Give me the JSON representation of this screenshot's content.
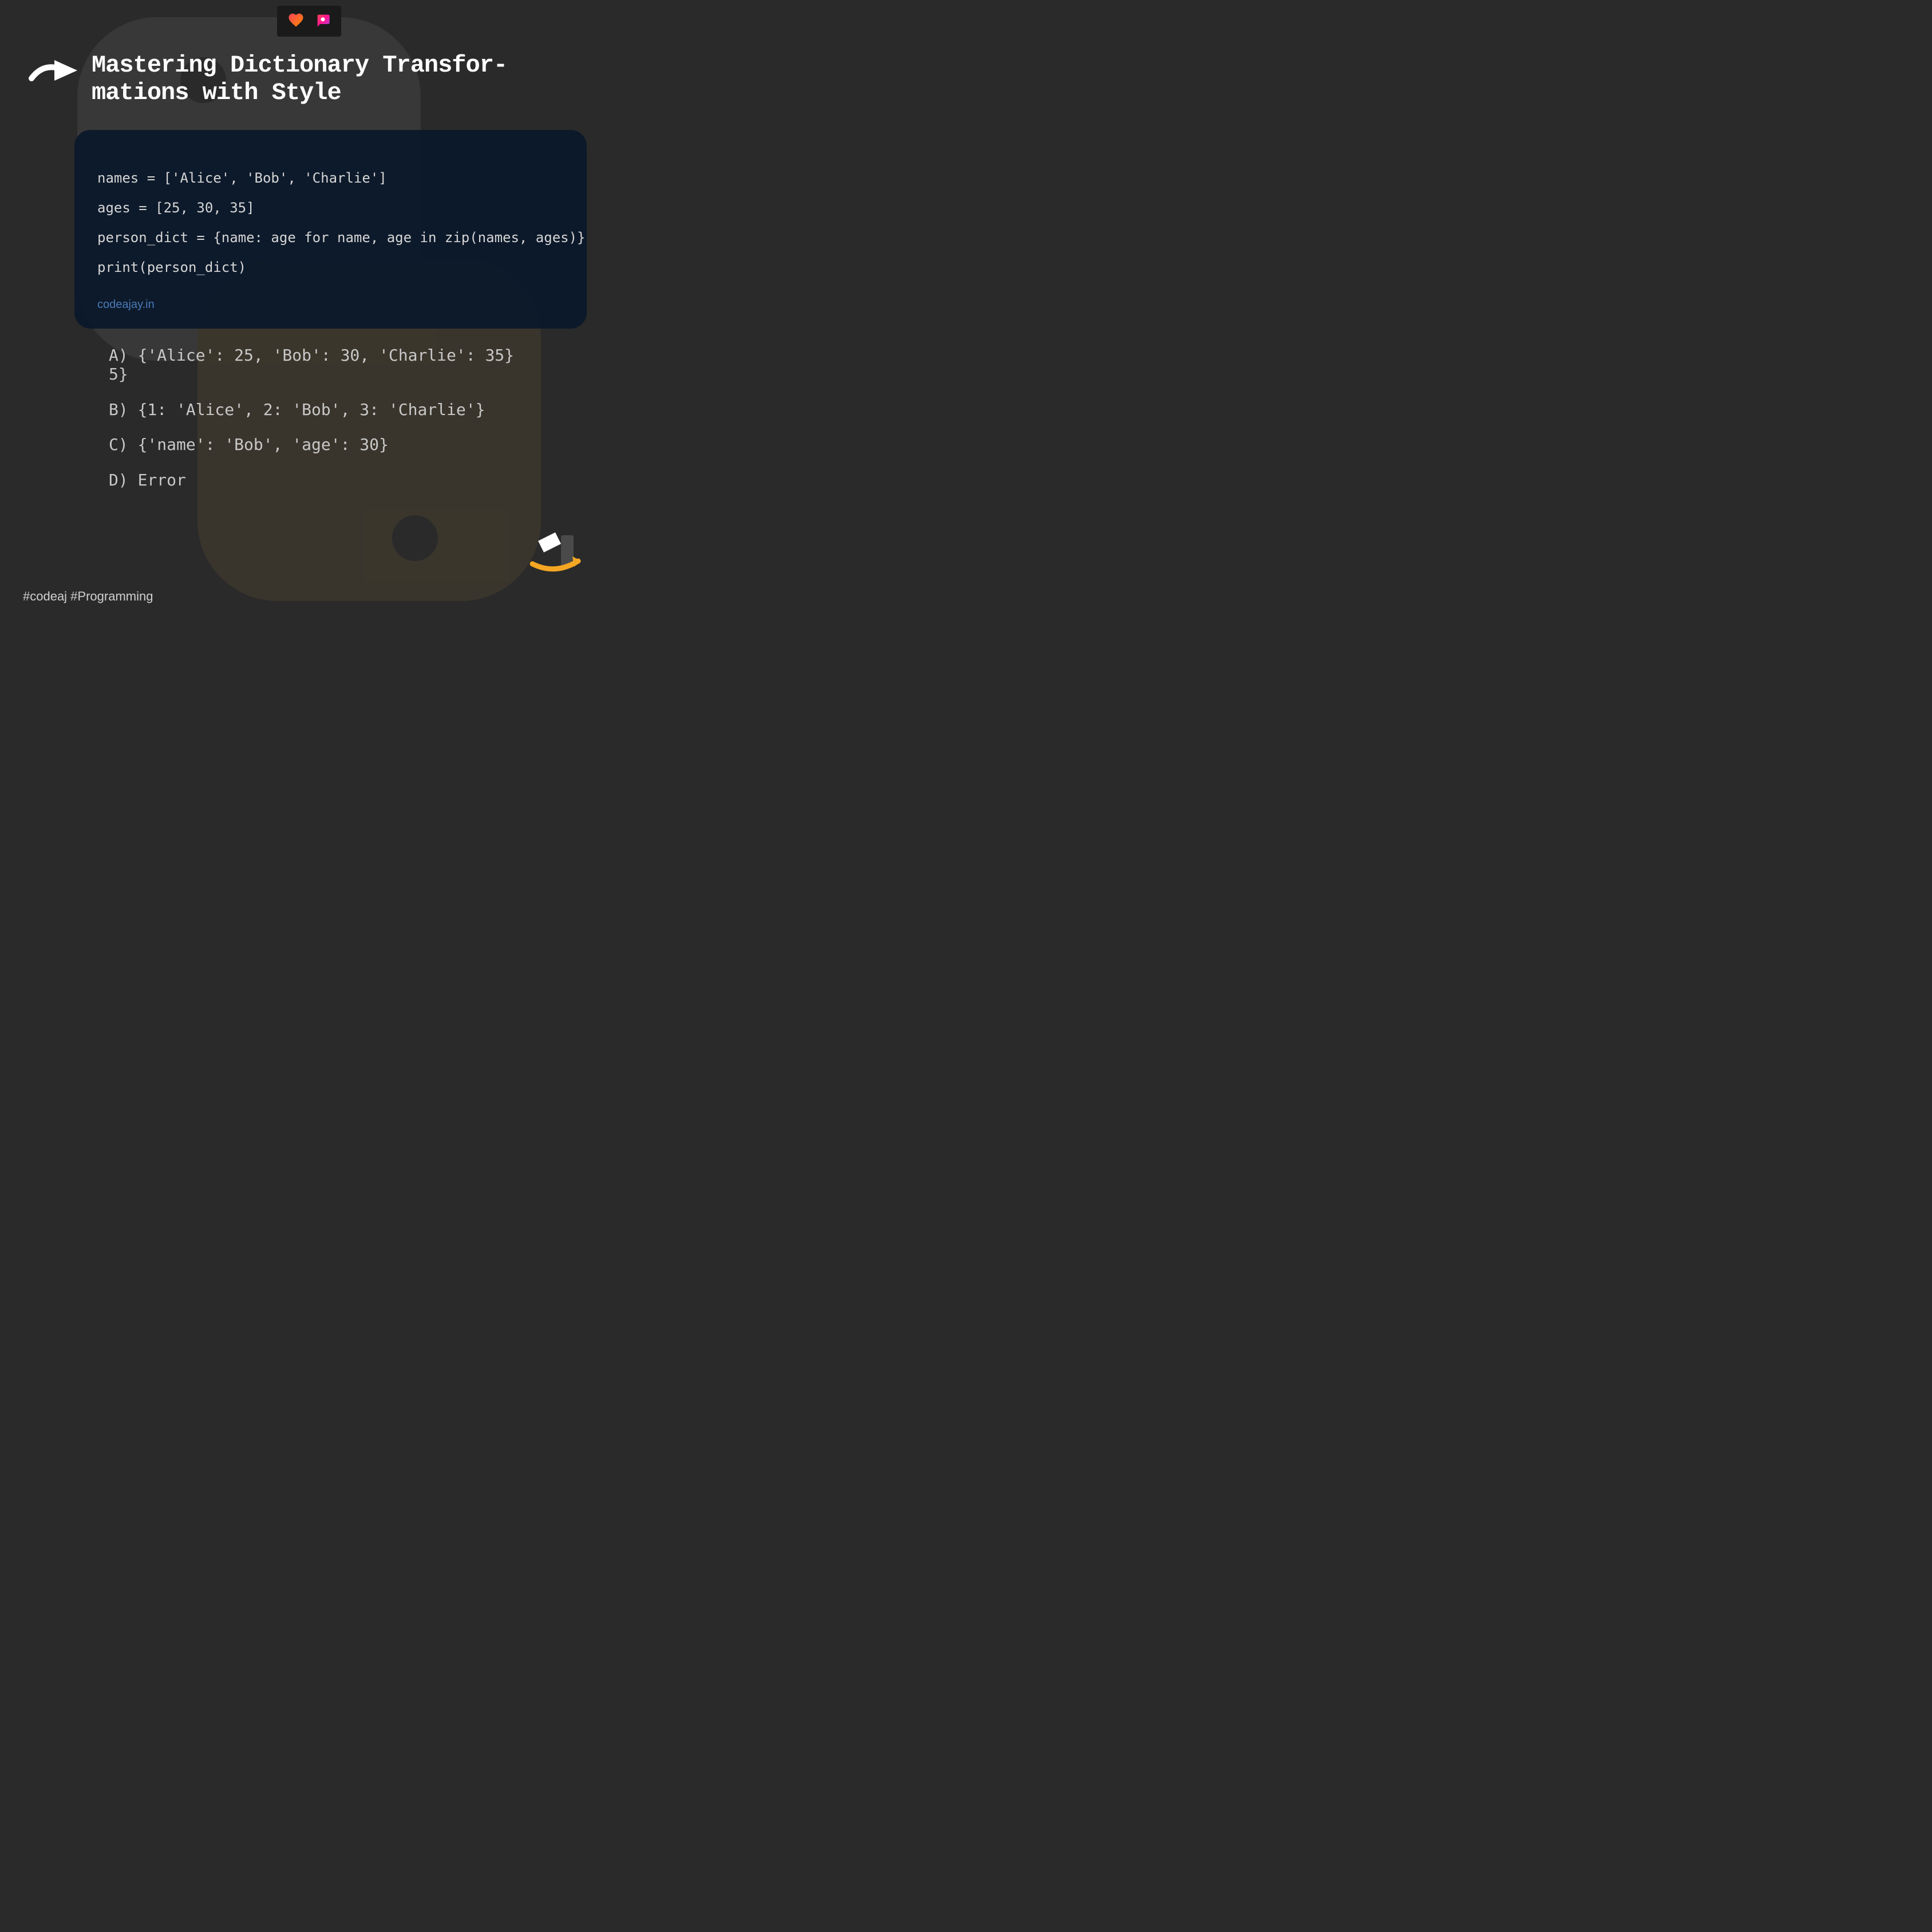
{
  "title": "Mastering Dictionary Transfor-\nmations with Style",
  "code": {
    "line1": "names = ['Alice', 'Bob', 'Charlie']",
    "line2": "ages = [25, 30, 35]",
    "line3": "person_dict = {name: age for name, age in zip(names, ages)}",
    "line4": "print(person_dict)",
    "watermark": "codeajay.in"
  },
  "options": {
    "a": "A) {'Alice': 25, 'Bob': 30, 'Charlie': 35}\n5}",
    "b": "B) {1: 'Alice', 2: 'Bob', 3: 'Charlie'}",
    "c": "C) {'name': 'Bob', 'age': 30}",
    "d": "D) Error"
  },
  "hashtags": "#codeaj #Programming"
}
